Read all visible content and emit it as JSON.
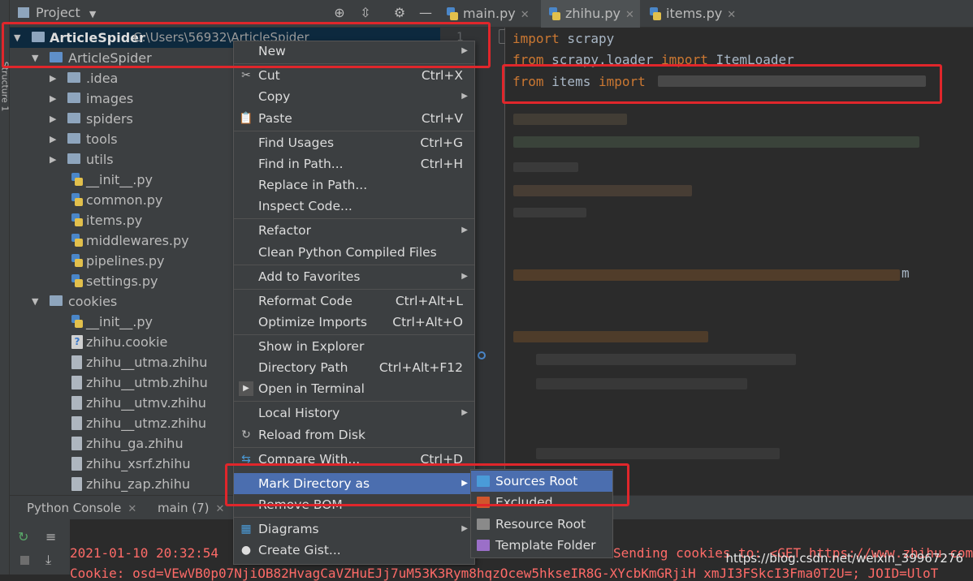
{
  "project_panel": {
    "title": "Project",
    "root": {
      "name": "ArticleSpider",
      "path": "C:\\Users\\56932\\ArticleSpider"
    },
    "tree": [
      {
        "label": "ArticleSpider",
        "kind": "folder-blue",
        "level": 1,
        "expanded": true
      },
      {
        "label": ".idea",
        "kind": "folder",
        "level": 2,
        "expanded": false
      },
      {
        "label": "images",
        "kind": "folder",
        "level": 2,
        "expanded": false
      },
      {
        "label": "spiders",
        "kind": "folder",
        "level": 2,
        "expanded": false
      },
      {
        "label": "tools",
        "kind": "folder",
        "level": 2,
        "expanded": false
      },
      {
        "label": "utils",
        "kind": "folder",
        "level": 2,
        "expanded": false
      },
      {
        "label": "__init__.py",
        "kind": "python",
        "level": 2
      },
      {
        "label": "common.py",
        "kind": "python",
        "level": 2
      },
      {
        "label": "items.py",
        "kind": "python",
        "level": 2
      },
      {
        "label": "middlewares.py",
        "kind": "python",
        "level": 2
      },
      {
        "label": "pipelines.py",
        "kind": "python",
        "level": 2
      },
      {
        "label": "settings.py",
        "kind": "python",
        "level": 2
      },
      {
        "label": "cookies",
        "kind": "folder",
        "level": 1,
        "expanded": true
      },
      {
        "label": "__init__.py",
        "kind": "python",
        "level": 2
      },
      {
        "label": "zhihu.cookie",
        "kind": "unknown",
        "level": 2
      },
      {
        "label": "zhihu__utma.zhihu",
        "kind": "file",
        "level": 2
      },
      {
        "label": "zhihu__utmb.zhihu",
        "kind": "file",
        "level": 2
      },
      {
        "label": "zhihu__utmv.zhihu",
        "kind": "file",
        "level": 2
      },
      {
        "label": "zhihu__utmz.zhihu",
        "kind": "file",
        "level": 2
      },
      {
        "label": "zhihu_ga.zhihu",
        "kind": "file",
        "level": 2
      },
      {
        "label": "zhihu_xsrf.zhihu",
        "kind": "file",
        "level": 2
      },
      {
        "label": "zhihu_zap.zhihu",
        "kind": "file",
        "level": 2
      }
    ]
  },
  "editor": {
    "tabs": [
      {
        "label": "main.py"
      },
      {
        "label": "zhihu.py"
      },
      {
        "label": "items.py"
      }
    ],
    "line_number": "1",
    "code": [
      {
        "kw1": "import",
        "rest1": " scrapy"
      },
      {
        "kw1": "from",
        "rest1": " scrapy.loader ",
        "kw2": "import",
        "rest2": " ItemLoader"
      },
      {
        "kw1": "from",
        "rest1": " items ",
        "kw2": "import"
      }
    ],
    "partial_char": "m"
  },
  "bottom": {
    "tabs": [
      {
        "label": "Python Console"
      },
      {
        "label": "main (7)"
      }
    ],
    "console": {
      "line1": "2021-01-10 20:32:54",
      "line1_tail": "Sending cookies to: <GET https://www.zhihu.com",
      "line2": "Cookie: osd=VEwVB0p07NjiOB82HvagCaVZHuEJj7uM53K3Rym8hqzOcew5hkseIR8G-XYcbKmGRjiH xmJI3FSkcI3Fma0T2U=; JOID=UloT"
    },
    "watermark": "https://blog.csdn.net/weixin_39967276"
  },
  "left_strip_tab": "Structure 1",
  "context_menu": {
    "items": [
      {
        "label": "New",
        "submenu": true
      },
      {
        "label": "Cut",
        "shortcut": "Ctrl+X",
        "icon": "scissors-icon"
      },
      {
        "label": "Copy",
        "submenu": true
      },
      {
        "label": "Paste",
        "shortcut": "Ctrl+V",
        "icon": "clipboard-icon"
      },
      {
        "label": "Find Usages",
        "shortcut": "Ctrl+G"
      },
      {
        "label": "Find in Path...",
        "shortcut": "Ctrl+H"
      },
      {
        "label": "Replace in Path..."
      },
      {
        "label": "Inspect Code..."
      },
      {
        "label": "Refactor",
        "submenu": true
      },
      {
        "label": "Clean Python Compiled Files"
      },
      {
        "label": "Add to Favorites",
        "submenu": true
      },
      {
        "label": "Reformat Code",
        "shortcut": "Ctrl+Alt+L"
      },
      {
        "label": "Optimize Imports",
        "shortcut": "Ctrl+Alt+O"
      },
      {
        "label": "Show in Explorer"
      },
      {
        "label": "Directory Path",
        "shortcut": "Ctrl+Alt+F12"
      },
      {
        "label": "Open in Terminal",
        "icon": "terminal-icon"
      },
      {
        "label": "Local History",
        "submenu": true
      },
      {
        "label": "Reload from Disk",
        "icon": "reload-icon"
      },
      {
        "label": "Compare With...",
        "shortcut": "Ctrl+D",
        "icon": "compare-icon"
      },
      {
        "label": "Mark Directory as",
        "submenu": true,
        "highlighted": true
      },
      {
        "label": "Remove BOM"
      },
      {
        "label": "Diagrams",
        "submenu": true,
        "icon": "diagram-icon"
      },
      {
        "label": "Create Gist...",
        "icon": "github-icon"
      }
    ]
  },
  "submenu": {
    "items": [
      {
        "label": "Sources Root",
        "color": "#4a9bd8",
        "highlighted": true
      },
      {
        "label": "Excluded",
        "color": "#d0562c"
      },
      {
        "label": "Resource Root",
        "color": "#8a8a8a"
      },
      {
        "label": "Template Folder",
        "color": "#9b6fc8"
      }
    ]
  },
  "colors": {
    "accent": "#4b6eaf",
    "annotation": "#e0262b",
    "keyword": "#cc7832"
  }
}
